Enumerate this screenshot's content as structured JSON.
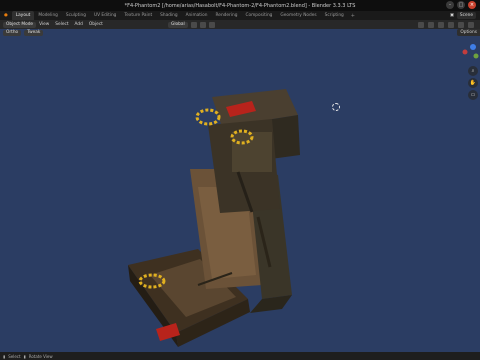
{
  "window": {
    "title": "*F4-Phantom2 [/home/arias/Hasabolt/F4-Phantom-2/F4-Phantom2.blend] - Blender 3.3.3 LTS"
  },
  "workspace_tabs": [
    {
      "label": "Layout",
      "active": true
    },
    {
      "label": "Modeling"
    },
    {
      "label": "Sculpting"
    },
    {
      "label": "UV Editing"
    },
    {
      "label": "Texture Paint"
    },
    {
      "label": "Shading"
    },
    {
      "label": "Animation"
    },
    {
      "label": "Rendering"
    },
    {
      "label": "Compositing"
    },
    {
      "label": "Geometry Nodes"
    },
    {
      "label": "Scripting"
    }
  ],
  "scene": {
    "name": "Scene"
  },
  "header": {
    "menus": [
      "Object Mode",
      "View",
      "Select",
      "Add",
      "Object"
    ],
    "orientation": "Global"
  },
  "toolbar2": {
    "view_menu": "View",
    "select_menu": "Select",
    "add_menu": "Add",
    "object_menu": "Object",
    "transform_label": "Ortho",
    "transform_mode": "Tweak",
    "options_label": "Options"
  },
  "statusbar": {
    "select": "Select",
    "rotate": "Rotate View"
  },
  "colors": {
    "viewport_bg": "#2b3d63",
    "accent_red": "#c7402c"
  }
}
